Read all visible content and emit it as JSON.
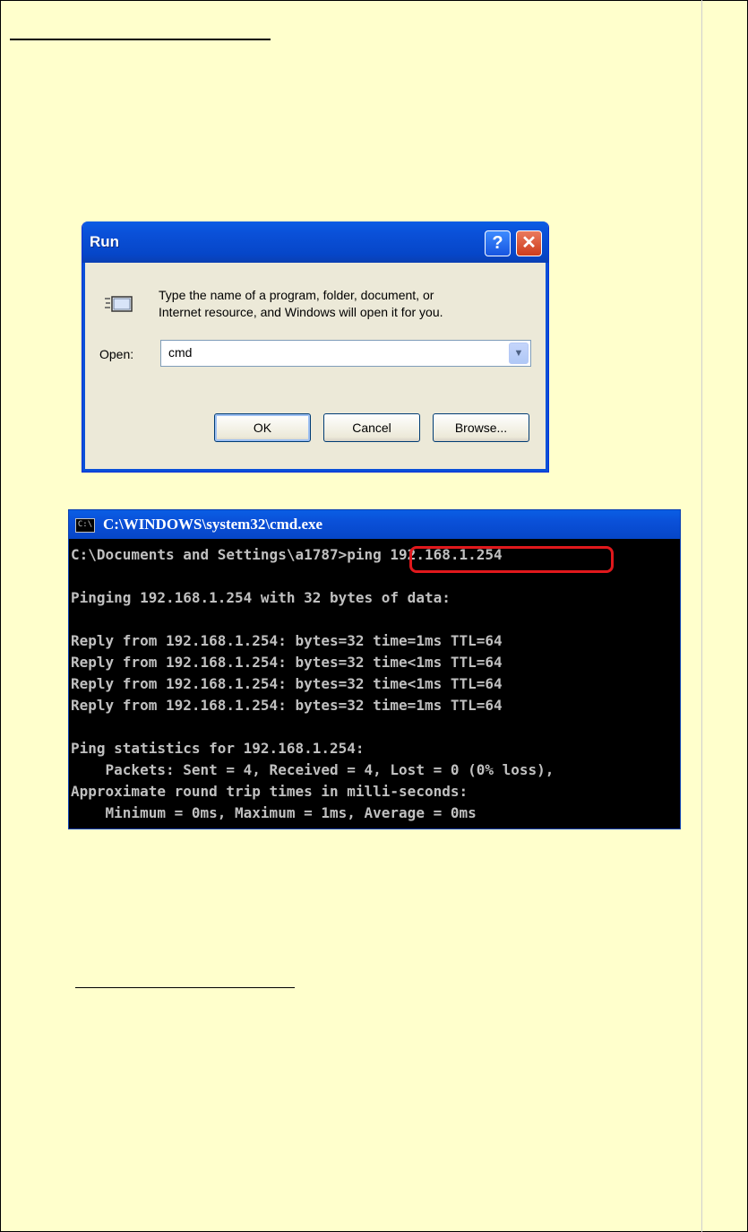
{
  "run_dialog": {
    "title": "Run",
    "help_glyph": "?",
    "close_glyph": "✕",
    "description_line1": "Type the name of a program, folder, document, or",
    "description_line2": "Internet resource, and Windows will open it for you.",
    "open_label": "Open:",
    "open_value": "cmd",
    "ok_label": "OK",
    "cancel_label": "Cancel",
    "browse_label": "Browse..."
  },
  "cmd_window": {
    "title": "C:\\WINDOWS\\system32\\cmd.exe",
    "icon_text": "C:\\",
    "lines": [
      "C:\\Documents and Settings\\a1787>ping 192.168.1.254",
      "",
      "Pinging 192.168.1.254 with 32 bytes of data:",
      "",
      "Reply from 192.168.1.254: bytes=32 time=1ms TTL=64",
      "Reply from 192.168.1.254: bytes=32 time<1ms TTL=64",
      "Reply from 192.168.1.254: bytes=32 time<1ms TTL=64",
      "Reply from 192.168.1.254: bytes=32 time=1ms TTL=64",
      "",
      "Ping statistics for 192.168.1.254:",
      "    Packets: Sent = 4, Received = 4, Lost = 0 (0% loss),",
      "Approximate round trip times in milli-seconds:",
      "    Minimum = 0ms, Maximum = 1ms, Average = 0ms"
    ]
  },
  "colors": {
    "page_background": "#ffffcc",
    "highlight_border": "#e0181c",
    "console_text": "#c0c0c0"
  }
}
